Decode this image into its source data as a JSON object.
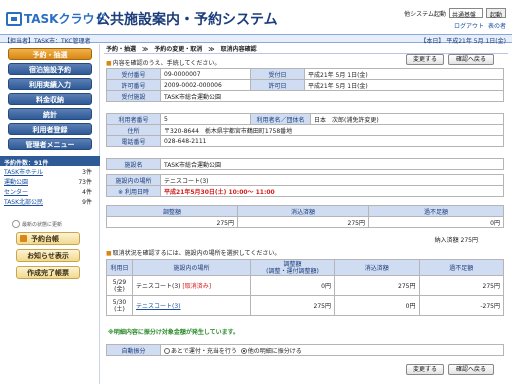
{
  "header": {
    "logo_text": "TASKクラウド",
    "system_title": "公共施設案内・予約システム",
    "switch_label": "他システム起動",
    "switch_value": "共通基盤",
    "launch_button": "起動",
    "logout_link": "ログアウト",
    "home_link": "表の者"
  },
  "topbar": {
    "left": "【担当者】TASK市：TKC管理者",
    "right": "【本日】 平成21年 5月 1日(金)"
  },
  "sidebar": {
    "menu": [
      {
        "label": "予約・抽選",
        "active": true
      },
      {
        "label": "宿泊施設予約",
        "active": false
      },
      {
        "label": "利用実績入力",
        "active": false
      },
      {
        "label": "料金収納",
        "active": false
      },
      {
        "label": "統計",
        "active": false
      },
      {
        "label": "利用者登録",
        "active": false
      },
      {
        "label": "管理者メニュー",
        "active": false
      }
    ],
    "count_title": "予約件数：91件",
    "counts": [
      {
        "label": "TASK市ホテル",
        "value": "3件"
      },
      {
        "label": "運動公園",
        "value": "73件"
      },
      {
        "label": "センター",
        "value": "4件"
      },
      {
        "label": "TASK北部公民",
        "value": "9件"
      }
    ],
    "refresh_text": "最新の状態に更新",
    "buttons": [
      "予約台帳",
      "お知らせ表示",
      "作成完了帳票"
    ]
  },
  "main": {
    "breadcrumb": "予約・抽選　≫　予約の変更・取消　≫　取消内容確認",
    "instruction": "内容を確認のうえ、手続してください。",
    "btn_change": "変更する",
    "btn_back": "確認へ戻る",
    "info": {
      "receipt_no_label": "受付番号",
      "receipt_no": "09-0000007",
      "receipt_date_label": "受付日",
      "receipt_date": "平成21年 5月 1日(金)",
      "permit_no_label": "許可番号",
      "permit_no": "2009-0002-000006",
      "permit_date_label": "許可日",
      "permit_date": "平成21年 5月 1日(金)",
      "facility_label": "受付施設",
      "facility": "TASK市総合運動公園"
    },
    "user": {
      "user_no_label": "利用者番号",
      "user_no": "5",
      "user_name_label": "利用者名／団体名",
      "user_name": "日本　次郎(浦免許変更)",
      "address_label": "住所",
      "address": "〒320-8644　栃木県宇都宮市鶴田町1758番地",
      "phone_label": "電話番号",
      "phone": "028-648-2111"
    },
    "place": {
      "facility_label": "施設名",
      "facility": "TASK市総合運動公園",
      "place_label": "施設内の場所",
      "place": "テニスコート(3)",
      "date_label": "※ 利用日時",
      "date": "平成21年5月30日(土) 10:00～ 11:00"
    },
    "fees": {
      "headers": [
        "調整額",
        "消込済額",
        "過不足額"
      ],
      "values": [
        "275円",
        "275円",
        "0円"
      ],
      "total_label": "納入済額 275円"
    },
    "instruction2": "取消状況を確認するには、施設内の場所を選択してください。",
    "detail": {
      "headers": [
        "利用日",
        "施設内の場所",
        "調整額\n(調整・運付調整額)",
        "消込済額",
        "過不足額"
      ],
      "rows": [
        {
          "date": "5/29\n(金)",
          "place": "テニスコート(3)",
          "status": "[取消済み]",
          "adjust": "0円",
          "paid": "275円",
          "diff": "275円"
        },
        {
          "date": "5/30\n(土)",
          "place": "テニスコート(3)",
          "status": "",
          "adjust": "275円",
          "paid": "0円",
          "diff": "-275円"
        }
      ]
    },
    "green_note": "※明細内容に振分け対象金額が発生しています。",
    "auto_label": "自動振分",
    "radio1": "あとで運付・充当を行う",
    "radio2": "他の明細に振分ける",
    "bottom_btn_change": "変更する",
    "bottom_btn_back": "確認へ戻る"
  }
}
